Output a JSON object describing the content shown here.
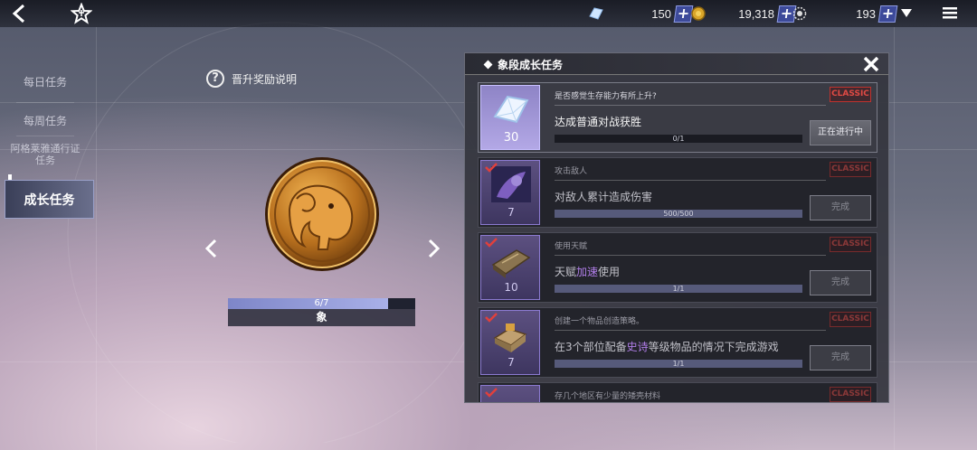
{
  "topbar": {
    "resources": [
      {
        "icon": "crystal-icon",
        "value": "150"
      },
      {
        "icon": "gold-coin-icon",
        "value": "19,318"
      },
      {
        "icon": "ticket-icon",
        "value": "193"
      }
    ]
  },
  "left_menu": {
    "items": [
      "每日任务",
      "每周任务",
      "阿格莱雅通行证\n任务"
    ],
    "active": "成长任务"
  },
  "center": {
    "help_text": "晋升奖励说明",
    "progress_text": "6/7",
    "progress_fraction": 0.857,
    "rank_name": "象"
  },
  "panel": {
    "title": "象段成长任务",
    "quests": [
      {
        "reward_icon": "crystal-icon",
        "reward_count": "30",
        "subtitle": "是否感觉生存能力有所上升?",
        "badge": "CLASSIC",
        "main": "达成普通对战获胜",
        "progress_text": "0/1",
        "progress_fraction": 0.0,
        "button": "正在进行中",
        "completed": false
      },
      {
        "reward_icon": "card-icon",
        "reward_count": "7",
        "subtitle": "攻击敌人",
        "badge": "CLASSIC",
        "main": "对敌人累计造成伤害",
        "progress_text": "500/500",
        "progress_fraction": 1.0,
        "button": "完成",
        "completed": true
      },
      {
        "reward_icon": "book-icon",
        "reward_count": "10",
        "subtitle": "使用天赋",
        "badge": "CLASSIC",
        "main_prefix": "天赋",
        "main_highlight": "加速",
        "main_suffix": "使用",
        "progress_text": "1/1",
        "progress_fraction": 1.0,
        "button": "完成",
        "completed": true
      },
      {
        "reward_icon": "box-icon",
        "reward_count": "7",
        "subtitle": "创建一个物品创造策略。",
        "badge": "CLASSIC",
        "main_prefix": "在3个部位配备",
        "main_highlight": "史诗",
        "main_suffix": "等级物品的情况下完成游戏",
        "progress_text": "1/1",
        "progress_fraction": 1.0,
        "button": "完成",
        "completed": true
      },
      {
        "reward_icon": "item-icon",
        "reward_count": "",
        "subtitle": "存几个地区有少量的矮壳材料",
        "badge": "CLASSIC",
        "main": "",
        "progress_text": "",
        "progress_fraction": 0.0,
        "button": "",
        "completed": true
      }
    ]
  },
  "colors": {
    "accent": "#3d4a9a",
    "badge": "#e14a44",
    "highlight": "#b07ee8"
  }
}
